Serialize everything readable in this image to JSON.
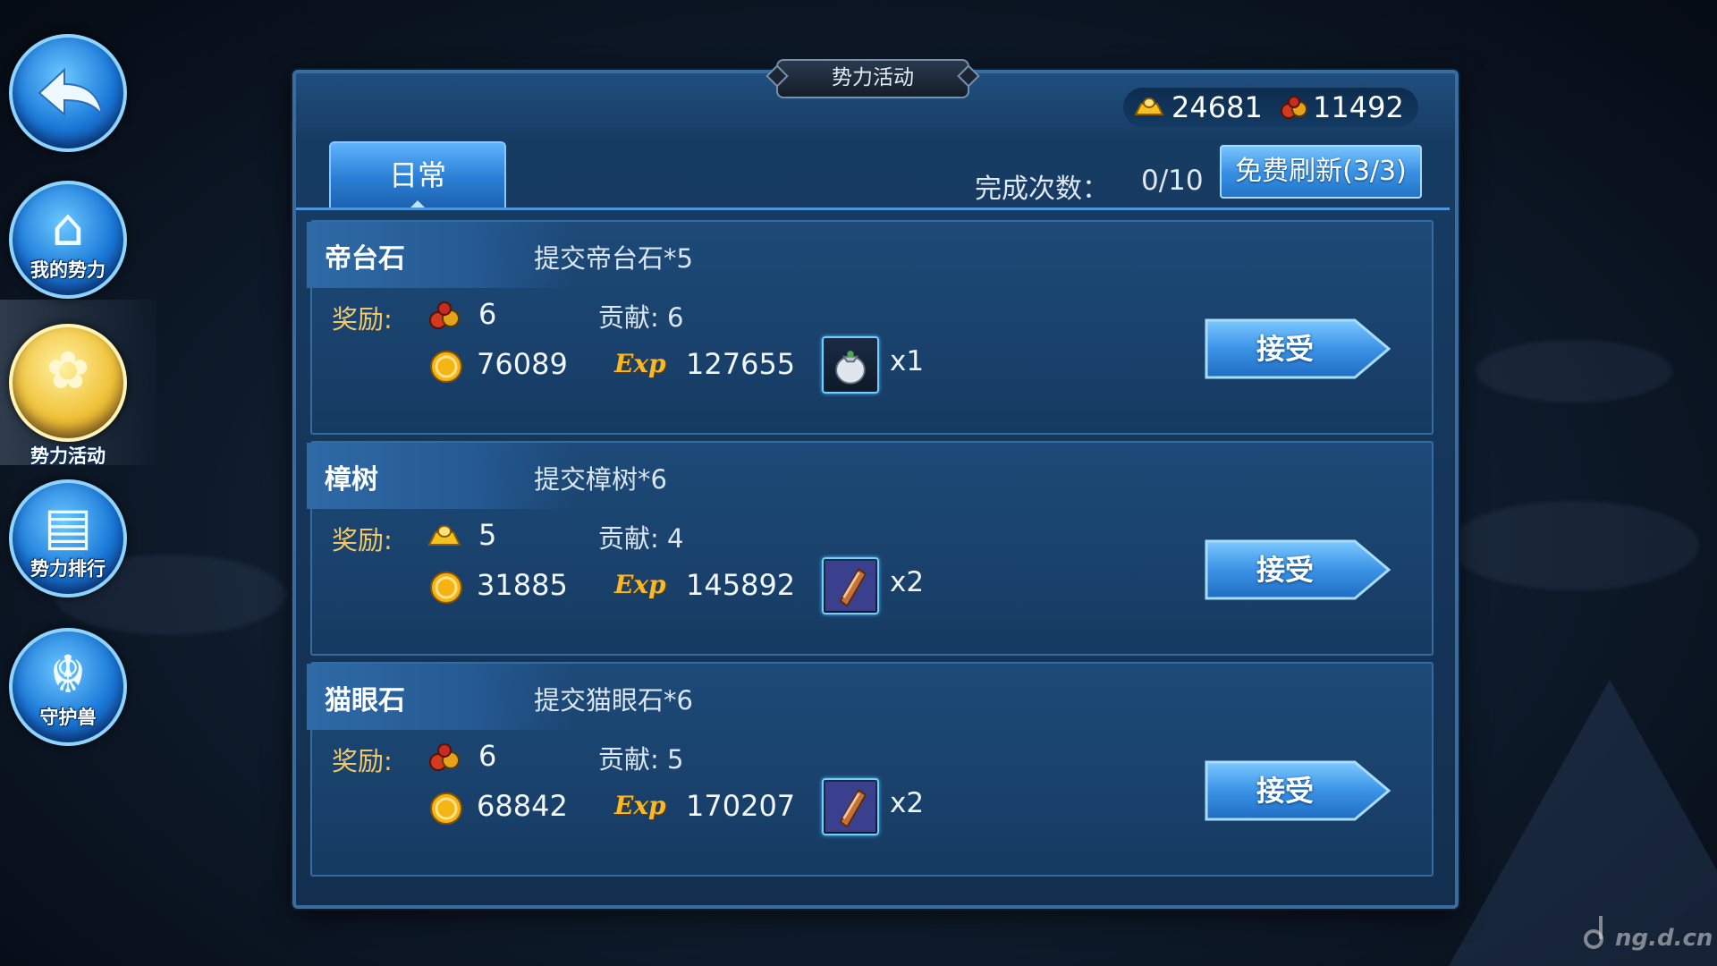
{
  "title": "势力活动",
  "currency": {
    "gold_icon": "gold-ingot-icon",
    "gold": "24681",
    "contribution_icon": "gift-pouch-icon",
    "contribution": "11492"
  },
  "tabs": [
    {
      "label": "日常",
      "active": true
    }
  ],
  "complete": {
    "label": "完成次数：",
    "value": "0/10"
  },
  "refresh_label": "免费刷新(3/3)",
  "nav": [
    {
      "label": "我的势力",
      "glyph": "⌂",
      "icon": "faction-hall-icon",
      "active": false
    },
    {
      "label": "势力活动",
      "glyph": "✿",
      "icon": "faction-activity-icon",
      "active": true
    },
    {
      "label": "势力排行",
      "glyph": "▤",
      "icon": "faction-ranking-icon",
      "active": false
    },
    {
      "label": "守护兽",
      "glyph": "☬",
      "icon": "guardian-beast-icon",
      "active": false
    }
  ],
  "tasks": [
    {
      "name": "帝台石",
      "desc": "提交帝台石*5",
      "reward_label": "奖励:",
      "reward_icon": "gift-pouch-icon",
      "reward_value": "6",
      "contrib": "贡献: 6",
      "coin": "76089",
      "exp_label": "Exp",
      "exp": "127655",
      "item_icon": "silver-pouch-icon",
      "item_qty": "x1",
      "accept": "接受"
    },
    {
      "name": "樟树",
      "desc": "提交樟树*6",
      "reward_label": "奖励:",
      "reward_icon": "gold-ingot-icon",
      "reward_value": "5",
      "contrib": "贡献: 4",
      "coin": "31885",
      "exp_label": "Exp",
      "exp": "145892",
      "item_icon": "scroll-icon",
      "item_qty": "x2",
      "accept": "接受"
    },
    {
      "name": "猫眼石",
      "desc": "提交猫眼石*6",
      "reward_label": "奖励:",
      "reward_icon": "gift-pouch-icon",
      "reward_value": "6",
      "contrib": "贡献: 5",
      "coin": "68842",
      "exp_label": "Exp",
      "exp": "170207",
      "item_icon": "scroll-icon",
      "item_qty": "x2",
      "accept": "接受"
    }
  ],
  "watermark": "ng.d.cn"
}
